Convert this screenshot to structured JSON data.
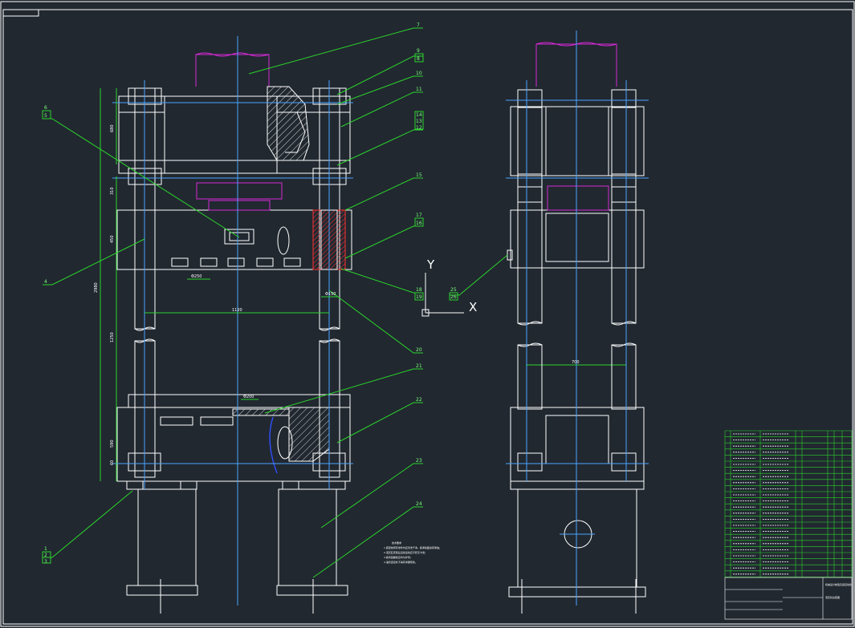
{
  "drawing": {
    "colors": {
      "background": "#212830",
      "outline": "#ffffff",
      "centerline": "#4aa3ff",
      "leader": "#2bd42b",
      "dimension": "#2bd42b",
      "hidden": "#d52ad5",
      "section_hatch": "#ffffff",
      "red_mark": "#ff3030",
      "blue_curve": "#3050ff"
    },
    "balloons_left": [
      {
        "id": "b6",
        "text": "6"
      },
      {
        "id": "b5",
        "text": "5"
      },
      {
        "id": "b4",
        "text": "4"
      },
      {
        "id": "b1",
        "text": "1"
      },
      {
        "id": "b2",
        "text": "2"
      },
      {
        "id": "b3",
        "text": "3"
      }
    ],
    "balloons_right": [
      {
        "id": "b7",
        "text": "7"
      },
      {
        "id": "b9",
        "text": "9"
      },
      {
        "id": "b8",
        "text": "8"
      },
      {
        "id": "b10",
        "text": "10"
      },
      {
        "id": "b11",
        "text": "11"
      },
      {
        "id": "b14",
        "text": "14"
      },
      {
        "id": "b13",
        "text": "13"
      },
      {
        "id": "b12",
        "text": "12"
      },
      {
        "id": "b15",
        "text": "15"
      },
      {
        "id": "b17",
        "text": "17"
      },
      {
        "id": "b16",
        "text": "16"
      },
      {
        "id": "b18",
        "text": "18"
      },
      {
        "id": "b19",
        "text": "19"
      },
      {
        "id": "b20",
        "text": "20"
      },
      {
        "id": "b21",
        "text": "21"
      },
      {
        "id": "b22",
        "text": "22"
      },
      {
        "id": "b23",
        "text": "23"
      },
      {
        "id": "b24",
        "text": "24"
      },
      {
        "id": "b25",
        "text": "25"
      },
      {
        "id": "b26",
        "text": "26"
      }
    ],
    "dimensions": {
      "overall_height": "2980",
      "upper_beam": "680",
      "gap": "310",
      "slide": "450",
      "stroke": "1250",
      "base": "590",
      "base_low": "60",
      "column_span": "1120",
      "column_dia": "Φ150",
      "tslot": "Φ250",
      "tslot2": "Φ200",
      "side_span": "700"
    },
    "axes": {
      "y": "Y",
      "x": "X"
    },
    "notes_title": "技术要求",
    "notes": [
      "1.装配前所有零件均应清洗干净，各滑动面涂润滑油；",
      "2.液压缸安装后活塞运动应平稳无卡滞；",
      "3.各紧固螺栓应均匀拧紧；",
      "4.油管连接处不得有渗漏现象。"
    ],
    "title_block": {
      "title": "四柱液压机装配图",
      "subtitle": "液压机总装图",
      "company": "机械设计制造及其自动化",
      "row_count": 24
    }
  }
}
